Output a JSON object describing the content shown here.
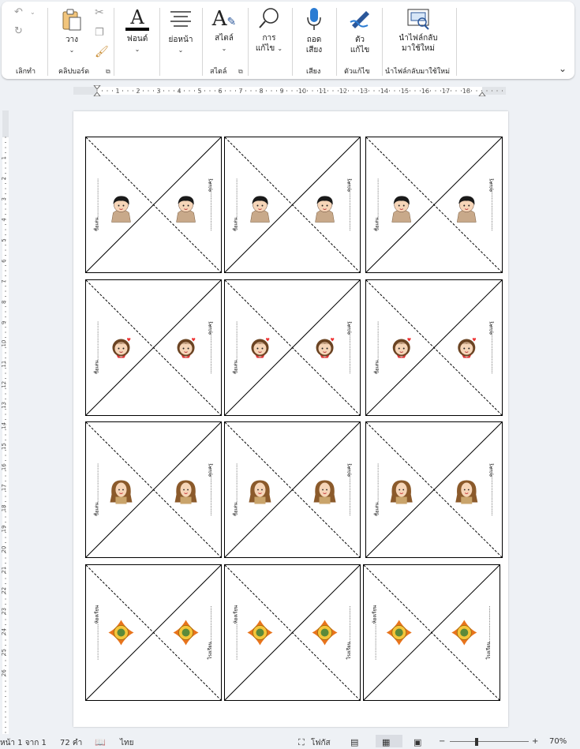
{
  "ribbon": {
    "undo": {
      "label": "เลิกทำ"
    },
    "clipboard": {
      "paste_label": "วาง",
      "group_label": "คลิปบอร์ด"
    },
    "font": {
      "label": "ฟอนต์"
    },
    "paragraph": {
      "label": "ย่อหน้า"
    },
    "styles": {
      "label": "สไตล์",
      "group_label": "สไตล์"
    },
    "editing": {
      "label_line1": "การ",
      "label_line2": "แก้ไข"
    },
    "voice": {
      "label_line1": "ถอด",
      "label_line2": "เสียง",
      "group_label": "เสียง"
    },
    "editor": {
      "label_line1": "ตัว",
      "label_line2": "แก้ไข",
      "group_label": "ตัวแก้ไข"
    },
    "reuse": {
      "label_line1": "นำไฟล์กลับ",
      "label_line2": "มาใช้ใหม่",
      "group_label": "นำไฟล์กลับมาใช้ใหม่"
    }
  },
  "ruler_h": [
    "1",
    "2",
    "3",
    "4",
    "5",
    "6",
    "7",
    "8",
    "9",
    "10",
    "11",
    "12",
    "13",
    "14",
    "15",
    "16",
    "17",
    "18"
  ],
  "ruler_v": [
    "1",
    "2",
    "3",
    "4",
    "5",
    "6",
    "7",
    "8",
    "9",
    "10",
    "11",
    "12",
    "13",
    "14",
    "15",
    "16",
    "17",
    "18",
    "19",
    "20",
    "21",
    "22",
    "23",
    "24",
    "25",
    "26"
  ],
  "cards": {
    "rows": [
      {
        "character": "boy",
        "left_text": "ชื่อเล่น..........................",
        "right_text": "..........................คุณครู"
      },
      {
        "character": "girl",
        "left_text": "ชื่อเล่น..........................",
        "right_text": "..........................คุณครู"
      },
      {
        "character": "woman",
        "left_text": "ชื่อเล่น..........................",
        "right_text": "..........................คุณครู"
      },
      {
        "character": "emblem",
        "left_text": "........................ห้องเรียน",
        "right_text": "โรงเรียน........................"
      }
    ]
  },
  "status": {
    "page": "หน้า 1 จาก 1",
    "words": "72 คำ",
    "language": "ไทย",
    "focus": "โฟกัส",
    "zoom": "70%"
  },
  "colors": {
    "accent": "#2b579a",
    "paper": "#ffffff",
    "background": "#eef1f5"
  }
}
